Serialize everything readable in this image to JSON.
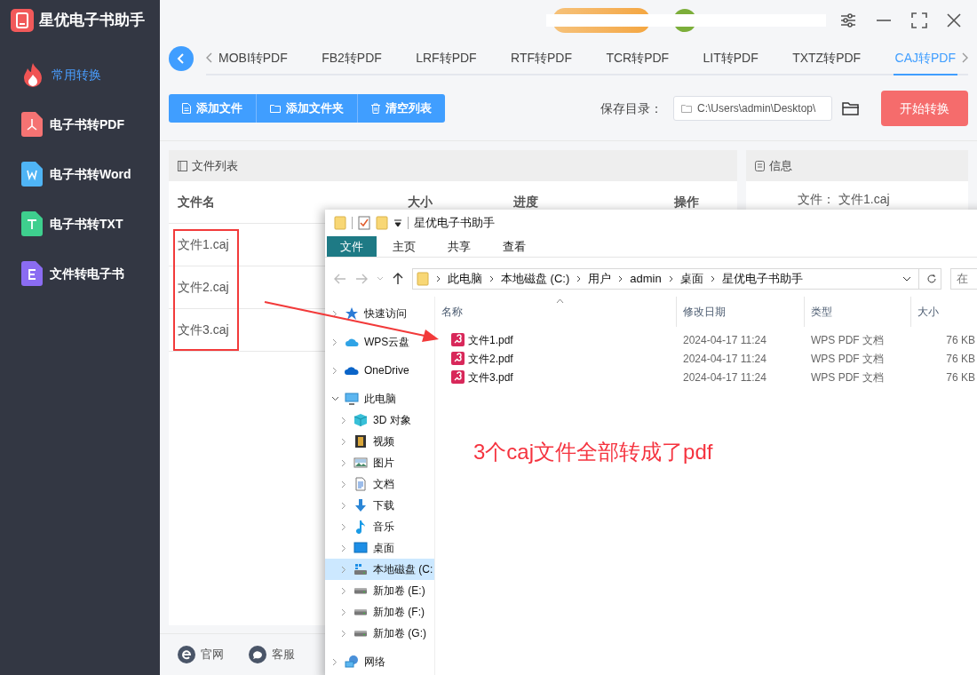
{
  "app": {
    "title": "星优电子书助手"
  },
  "sidebar": {
    "items": [
      {
        "label": "常用转换",
        "selected": true,
        "kind": "flame"
      },
      {
        "label": "电子书转PDF",
        "selected": false,
        "kind": "pdf"
      },
      {
        "label": "电子书转Word",
        "selected": false,
        "kind": "word"
      },
      {
        "label": "电子书转TXT",
        "selected": false,
        "kind": "txt"
      },
      {
        "label": "文件转电子书",
        "selected": false,
        "kind": "ebook"
      }
    ]
  },
  "tabs": [
    {
      "label": "MOBI转PDF",
      "selected": false
    },
    {
      "label": "FB2转PDF",
      "selected": false
    },
    {
      "label": "LRF转PDF",
      "selected": false
    },
    {
      "label": "RTF转PDF",
      "selected": false
    },
    {
      "label": "TCR转PDF",
      "selected": false
    },
    {
      "label": "LIT转PDF",
      "selected": false
    },
    {
      "label": "TXTZ转PDF",
      "selected": false
    },
    {
      "label": "CAJ转PDF",
      "selected": true
    }
  ],
  "toolbar": {
    "buttons": [
      {
        "label": "添加文件",
        "kind": "file"
      },
      {
        "label": "添加文件夹",
        "kind": "folder"
      },
      {
        "label": "清空列表",
        "kind": "trash"
      }
    ],
    "save_label": "保存目录：",
    "save_path": "C:\\Users\\admin\\Desktop\\",
    "start_button": "开始转换"
  },
  "file_list": {
    "title": "文件列表",
    "columns": [
      "文件名",
      "大小",
      "进度",
      "操作"
    ],
    "rows": [
      {
        "name": "文件1.caj"
      },
      {
        "name": "文件2.caj"
      },
      {
        "name": "文件3.caj"
      }
    ]
  },
  "info": {
    "title": "信息",
    "file_label": "文件：",
    "file_value": "文件1.caj"
  },
  "footer": {
    "links": [
      {
        "label": "官网",
        "kind": "web"
      },
      {
        "label": "客服",
        "kind": "chat"
      }
    ]
  },
  "explorer": {
    "title": "星优电子书助手",
    "ribbon_tabs": [
      {
        "label": "文件",
        "selected": true
      },
      {
        "label": "主页",
        "selected": false
      },
      {
        "label": "共享",
        "selected": false
      },
      {
        "label": "查看",
        "selected": false
      }
    ],
    "breadcrumb": [
      "此电脑",
      "本地磁盘 (C:)",
      "用户",
      "admin",
      "桌面",
      "星优电子书助手"
    ],
    "search_placeholder": "在",
    "columns": [
      "名称",
      "修改日期",
      "类型",
      "大小"
    ],
    "files": [
      {
        "name": "文件1.pdf",
        "modified": "2024-04-17 11:24",
        "type": "WPS PDF 文档",
        "size": "76 KB"
      },
      {
        "name": "文件2.pdf",
        "modified": "2024-04-17 11:24",
        "type": "WPS PDF 文档",
        "size": "76 KB"
      },
      {
        "name": "文件3.pdf",
        "modified": "2024-04-17 11:24",
        "type": "WPS PDF 文档",
        "size": "76 KB"
      }
    ],
    "nav": [
      {
        "label": "快速访问",
        "kind": "star",
        "expanded": false,
        "selected": false
      },
      {
        "label": "WPS云盘",
        "kind": "cloud",
        "expanded": false,
        "selected": false
      },
      {
        "label": "OneDrive",
        "kind": "onedrive",
        "expanded": false,
        "selected": false
      },
      {
        "label": "此电脑",
        "kind": "pc",
        "expanded": true,
        "selected": false,
        "children": [
          {
            "label": "3D 对象",
            "kind": "cube",
            "expanded": false,
            "selected": false
          },
          {
            "label": "视频",
            "kind": "film",
            "expanded": false,
            "selected": false
          },
          {
            "label": "图片",
            "kind": "image",
            "expanded": false,
            "selected": false
          },
          {
            "label": "文档",
            "kind": "doc",
            "expanded": false,
            "selected": false
          },
          {
            "label": "下载",
            "kind": "download",
            "expanded": false,
            "selected": false
          },
          {
            "label": "音乐",
            "kind": "music",
            "expanded": false,
            "selected": false
          },
          {
            "label": "桌面",
            "kind": "desktop",
            "expanded": false,
            "selected": false
          },
          {
            "label": "本地磁盘 (C:",
            "kind": "windrive",
            "expanded": false,
            "selected": true
          },
          {
            "label": "新加卷 (E:)",
            "kind": "drive",
            "expanded": false,
            "selected": false
          },
          {
            "label": "新加卷 (F:)",
            "kind": "drive",
            "expanded": false,
            "selected": false
          },
          {
            "label": "新加卷 (G:)",
            "kind": "drive",
            "expanded": false,
            "selected": false
          }
        ]
      },
      {
        "label": "网络",
        "kind": "network",
        "expanded": false,
        "selected": false
      }
    ]
  },
  "annotation": {
    "text": "3个caj文件全部转成了pdf"
  }
}
